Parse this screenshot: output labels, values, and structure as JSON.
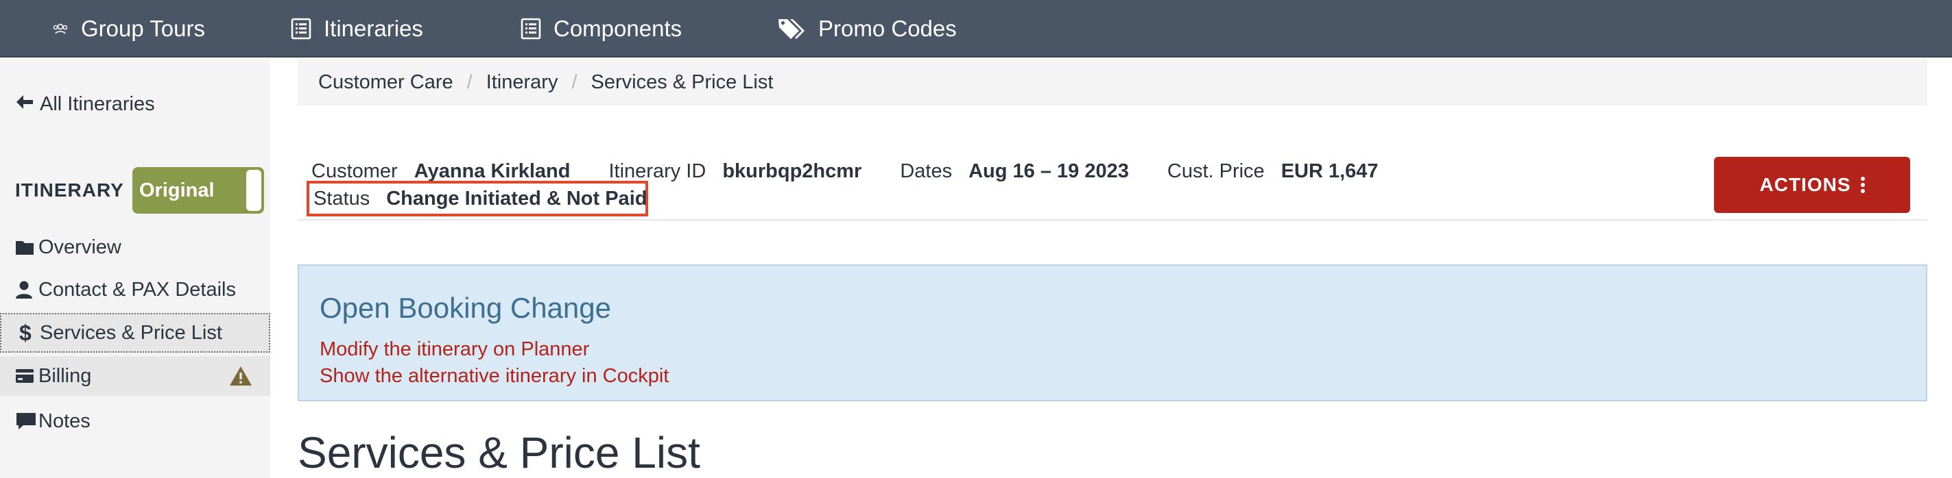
{
  "topnav": {
    "items": [
      {
        "label": "Group Tours",
        "icon": "group-icon"
      },
      {
        "label": "Itineraries",
        "icon": "list-icon"
      },
      {
        "label": "Components",
        "icon": "list-icon"
      },
      {
        "label": "Promo Codes",
        "icon": "tags-icon"
      }
    ]
  },
  "sidebar": {
    "back_label": "All Itineraries",
    "section_label": "ITINERARY",
    "toggle_label": "Original",
    "toggle_color": "#8a9a4b",
    "items": [
      {
        "label": "Overview",
        "icon": "folder-icon"
      },
      {
        "label": "Contact & PAX Details",
        "icon": "user-icon"
      },
      {
        "label": "Services & Price List",
        "icon": "dollar-icon",
        "active": true
      },
      {
        "label": "Billing",
        "icon": "credit-card-icon",
        "warning": true
      },
      {
        "label": "Notes",
        "icon": "comment-icon"
      }
    ]
  },
  "breadcrumb": [
    "Customer Care",
    "Itinerary",
    "Services & Price List"
  ],
  "breadcrumb_separator": "/",
  "info": {
    "customer_label": "Customer",
    "customer_value": "Ayanna Kirkland",
    "itinerary_id_label": "Itinerary ID",
    "itinerary_id_value": "bkurbqp2hcmr",
    "dates_label": "Dates",
    "dates_value": "Aug 16 – 19 2023",
    "price_label": "Cust. Price",
    "price_value": "EUR 1,647",
    "status_label": "Status",
    "status_value": "Change Initiated & Not Paid",
    "status_highlight_color": "#e0482a"
  },
  "actions_label": "ACTIONS",
  "actions_color": "#b52219",
  "booking_change": {
    "title": "Open Booking Change",
    "links": [
      "Modify the itinerary on Planner",
      "Show the alternative itinerary in Cockpit"
    ]
  },
  "section_title": "Services & Price List"
}
